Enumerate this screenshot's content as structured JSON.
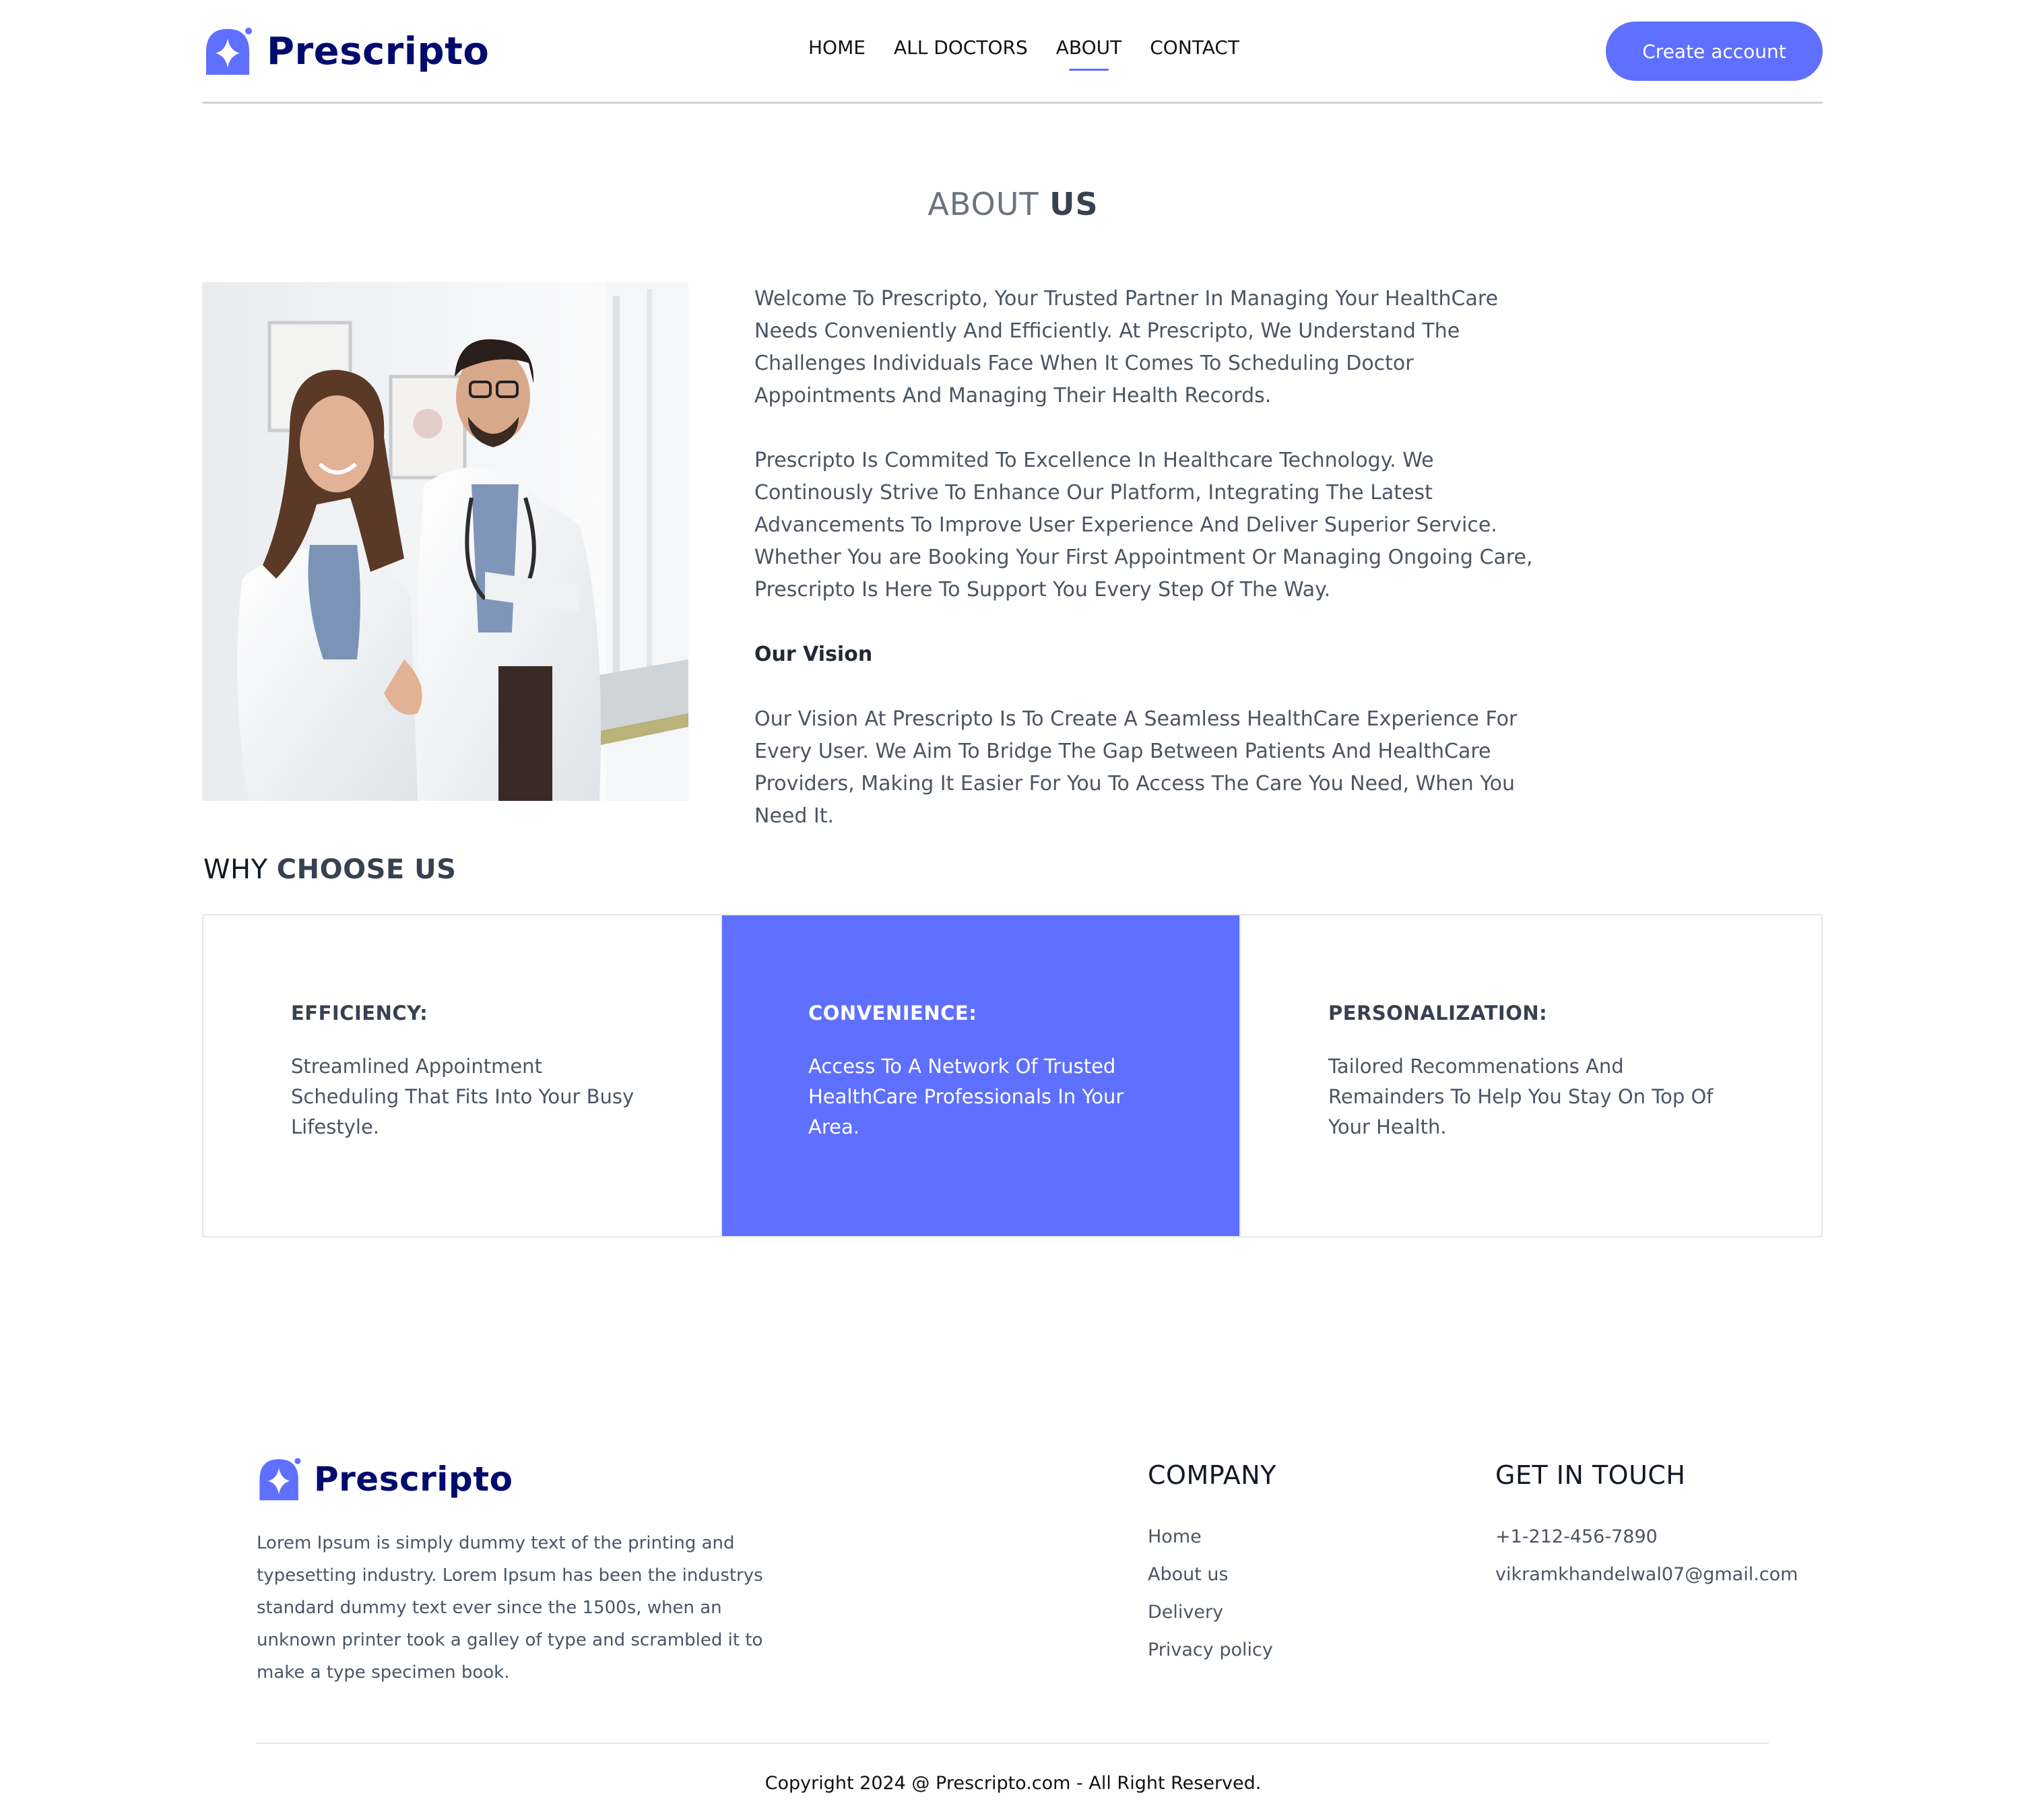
{
  "brand": {
    "name": "Prescripto",
    "accent": "#5f6fff",
    "logo_color": "#000b6d"
  },
  "nav": {
    "items": [
      {
        "label": "HOME",
        "active": false
      },
      {
        "label": "ALL DOCTORS",
        "active": false
      },
      {
        "label": "ABOUT",
        "active": true
      },
      {
        "label": "CONTACT",
        "active": false
      }
    ],
    "cta_label": "Create account"
  },
  "about": {
    "title_light": "ABOUT",
    "title_bold": "US",
    "image_icon": "doctors-photo",
    "paragraphs": [
      "Welcome To Prescripto, Your Trusted Partner In Managing Your HealthCare Needs Conveniently And Efficiently. At Prescripto, We Understand The Challenges Individuals Face When It Comes To Scheduling Doctor Appointments And Managing Their Health Records.",
      "Prescripto Is Commited To Excellence In Healthcare Technology. We Continously Strive To Enhance Our Platform, Integrating The Latest Advancements To Improve User Experience And Deliver Superior Service. Whether You are Booking Your First Appointment Or Managing Ongoing Care, Prescripto Is Here To Support You Every Step Of The Way."
    ],
    "vision_heading": "Our Vision",
    "vision_text": "Our Vision At Prescripto Is To Create A Seamless HealthCare Experience For Every User. We Aim To Bridge The Gap Between Patients And HealthCare Providers, Making It Easier For You To Access The Care You Need, When You Need It."
  },
  "why": {
    "title_light": "WHY",
    "title_bold": "CHOOSE US",
    "cards": [
      {
        "heading": "EFFICIENCY:",
        "text": "Streamlined Appointment Scheduling That Fits Into Your Busy Lifestyle.",
        "highlighted": false
      },
      {
        "heading": "CONVENIENCE:",
        "text": "Access To A Network Of Trusted HealthCare Professionals In Your Area.",
        "highlighted": true
      },
      {
        "heading": "PERSONALIZATION:",
        "text": "Tailored Recommenations And Remainders To Help You Stay On Top Of Your Health.",
        "highlighted": false
      }
    ]
  },
  "footer": {
    "description": "Lorem Ipsum is simply dummy text of the printing and typesetting industry. Lorem Ipsum has been the industrys standard dummy text ever since the 1500s, when an unknown printer took a galley of type and scrambled it to make a type specimen book.",
    "company_heading": "COMPANY",
    "company_links": [
      "Home",
      "About us",
      "Delivery",
      "Privacy policy"
    ],
    "contact_heading": "GET IN TOUCH",
    "phone": "+1-212-456-7890",
    "email": "vikramkhandelwal07@gmail.com",
    "copyright": "Copyright 2024 @ Prescripto.com - All Right Reserved."
  }
}
